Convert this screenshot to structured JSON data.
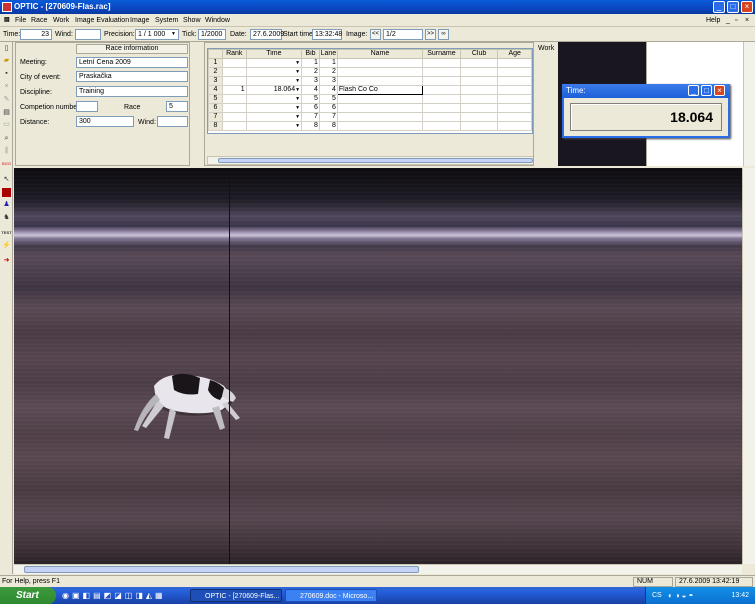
{
  "window": {
    "title": "OPTIC - [270609-Flas.rac]"
  },
  "menu": [
    "File",
    "Race",
    "Work",
    "Image Evaluation",
    "Image",
    "System",
    "Show",
    "Window"
  ],
  "menu_help": "Help",
  "toolbar": {
    "time_label": "Time:",
    "time_value": "23",
    "wind_label": "Wind:",
    "wind_value": "",
    "precision_label": "Precision:",
    "precision_value": "1 / 1 000",
    "tick_label": "Tick:",
    "tick_value": "1/2000",
    "date_label": "Date:",
    "date_value": "27.6.2009",
    "start_label": "Start time",
    "start_value": "13:32:48",
    "image_label": "Image:",
    "image_value": "1/2"
  },
  "race_info": {
    "header": "Race information",
    "meeting_label": "Meeting:",
    "meeting_value": "Letní Cena 2009",
    "city_label": "City of event:",
    "city_value": "Praskačka",
    "discipline_label": "Discipline:",
    "discipline_value": "Training",
    "competition_label": "Competion number:",
    "competition_value": "",
    "race_label": "Race",
    "race_value": "5",
    "distance_label": "Distance:",
    "distance_value": "300",
    "wind_label": "Wind:",
    "wind_value": ""
  },
  "results": {
    "columns": [
      "Rank",
      "Time",
      "Bib",
      "Lane",
      "Name",
      "Surname",
      "Club",
      "Age"
    ],
    "rows": [
      {
        "row": "1",
        "rank": "",
        "time": "",
        "bib": "1",
        "lane": "1",
        "name": ""
      },
      {
        "row": "2",
        "rank": "",
        "time": "",
        "bib": "2",
        "lane": "2",
        "name": ""
      },
      {
        "row": "3",
        "rank": "",
        "time": "",
        "bib": "3",
        "lane": "3",
        "name": ""
      },
      {
        "row": "4",
        "rank": "1",
        "time": "18.064",
        "bib": "4",
        "lane": "4",
        "name": "Flash Co Co"
      },
      {
        "row": "5",
        "rank": "",
        "time": "",
        "bib": "5",
        "lane": "5",
        "name": ""
      },
      {
        "row": "6",
        "rank": "",
        "time": "",
        "bib": "6",
        "lane": "6",
        "name": ""
      },
      {
        "row": "7",
        "rank": "",
        "time": "",
        "bib": "7",
        "lane": "7",
        "name": ""
      },
      {
        "row": "8",
        "rank": "",
        "time": "",
        "bib": "8",
        "lane": "8",
        "name": ""
      }
    ]
  },
  "work_panel": {
    "label": "Work"
  },
  "time_window": {
    "title": "Time:",
    "value": "18.064"
  },
  "left_tools": {
    "bgo": "BGO",
    "test": "TEST"
  },
  "statusbar": {
    "help": "For Help, press F1",
    "num": "NUM",
    "datetime": "27.6.2009  13:42:19"
  },
  "taskbar": {
    "start": "Start",
    "tasks": [
      "OPTIC - [270609-Flas...",
      "270609.doc - Microso..."
    ],
    "lang": "CS",
    "clock": "13:42"
  }
}
